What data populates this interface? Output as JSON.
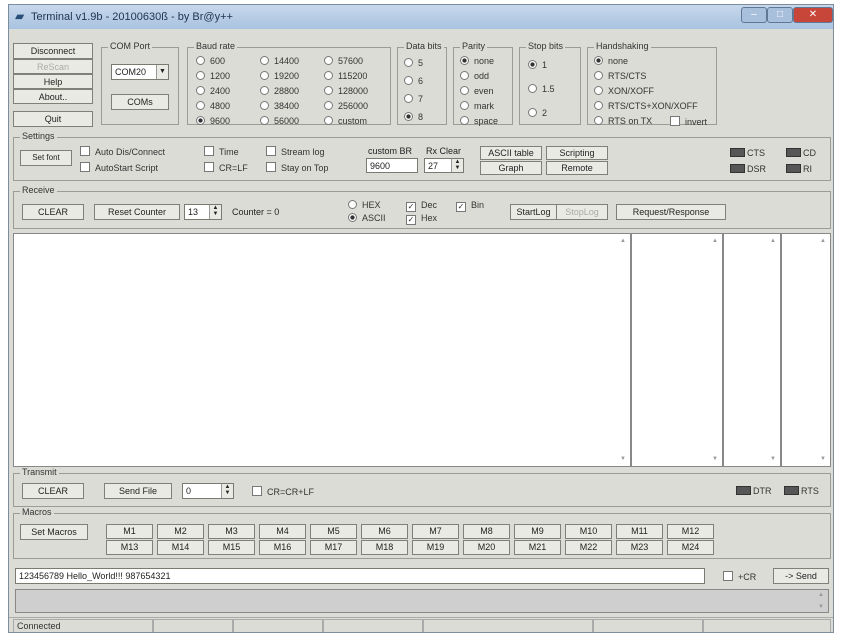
{
  "window": {
    "title": "Terminal v1.9b - 20100630ß - by Br@y++"
  },
  "connection_buttons": {
    "disconnect": "Disconnect",
    "rescan": "ReScan",
    "help": "Help",
    "about": "About..",
    "quit": "Quit"
  },
  "com_port": {
    "label": "COM Port",
    "value": "COM20",
    "coms_button": "COMs"
  },
  "baud_rate": {
    "label": "Baud rate",
    "options": [
      "600",
      "1200",
      "2400",
      "4800",
      "9600",
      "14400",
      "19200",
      "28800",
      "38400",
      "56000",
      "57600",
      "115200",
      "128000",
      "256000",
      "custom"
    ],
    "selected": "9600"
  },
  "data_bits": {
    "label": "Data bits",
    "options": [
      "5",
      "6",
      "7",
      "8"
    ],
    "selected": "8"
  },
  "parity": {
    "label": "Parity",
    "options": [
      "none",
      "odd",
      "even",
      "mark",
      "space"
    ],
    "selected": "none"
  },
  "stop_bits": {
    "label": "Stop bits",
    "options": [
      "1",
      "1.5",
      "2"
    ],
    "selected": "1"
  },
  "handshaking": {
    "label": "Handshaking",
    "options": [
      "none",
      "RTS/CTS",
      "XON/XOFF",
      "RTS/CTS+XON/XOFF",
      "RTS on TX"
    ],
    "selected": "none",
    "invert_label": "invert"
  },
  "settings": {
    "label": "Settings",
    "set_font": "Set font",
    "auto_dis_connect": "Auto Dis/Connect",
    "autostart_script": "AutoStart Script",
    "time": "Time",
    "cr_lf": "CR=LF",
    "stream_log": "Stream log",
    "stay_on_top": "Stay on Top",
    "custom_br_label": "custom BR",
    "custom_br_value": "9600",
    "rx_clear_label": "Rx Clear",
    "rx_clear_value": "27",
    "ascii_table": "ASCII table",
    "graph": "Graph",
    "scripting": "Scripting",
    "remote": "Remote"
  },
  "signals_top": {
    "cts": "CTS",
    "cd": "CD",
    "dsr": "DSR",
    "ri": "RI"
  },
  "receive": {
    "label": "Receive",
    "clear": "CLEAR",
    "reset_counter": "Reset Counter",
    "counter_spin": "13",
    "counter_text": "Counter = 0",
    "hex": "HEX",
    "ascii": "ASCII",
    "display_mode": "ASCII",
    "dec": "Dec",
    "hex_chk": "Hex",
    "bin": "Bin",
    "startlog": "StartLog",
    "stoplog": "StopLog",
    "request_response": "Request/Response"
  },
  "transmit": {
    "label": "Transmit",
    "clear": "CLEAR",
    "send_file": "Send File",
    "spin_value": "0",
    "cr_crlf": "CR=CR+LF",
    "dtr": "DTR",
    "rts": "RTS"
  },
  "macros": {
    "label": "Macros",
    "set_macros": "Set Macros",
    "row1": [
      "M1",
      "M2",
      "M3",
      "M4",
      "M5",
      "M6",
      "M7",
      "M8",
      "M9",
      "M10",
      "M11",
      "M12"
    ],
    "row2": [
      "M13",
      "M14",
      "M15",
      "M16",
      "M17",
      "M18",
      "M19",
      "M20",
      "M21",
      "M22",
      "M23",
      "M24"
    ]
  },
  "send": {
    "input_value": "123456789 Hello_World!!! 987654321",
    "plus_cr": "+CR",
    "send_button": "-> Send"
  },
  "status": {
    "text": "Connected"
  },
  "icons": {
    "app": "terminal-icon",
    "minimize": "minimize-icon",
    "maximize": "maximize-icon",
    "close": "close-icon"
  }
}
